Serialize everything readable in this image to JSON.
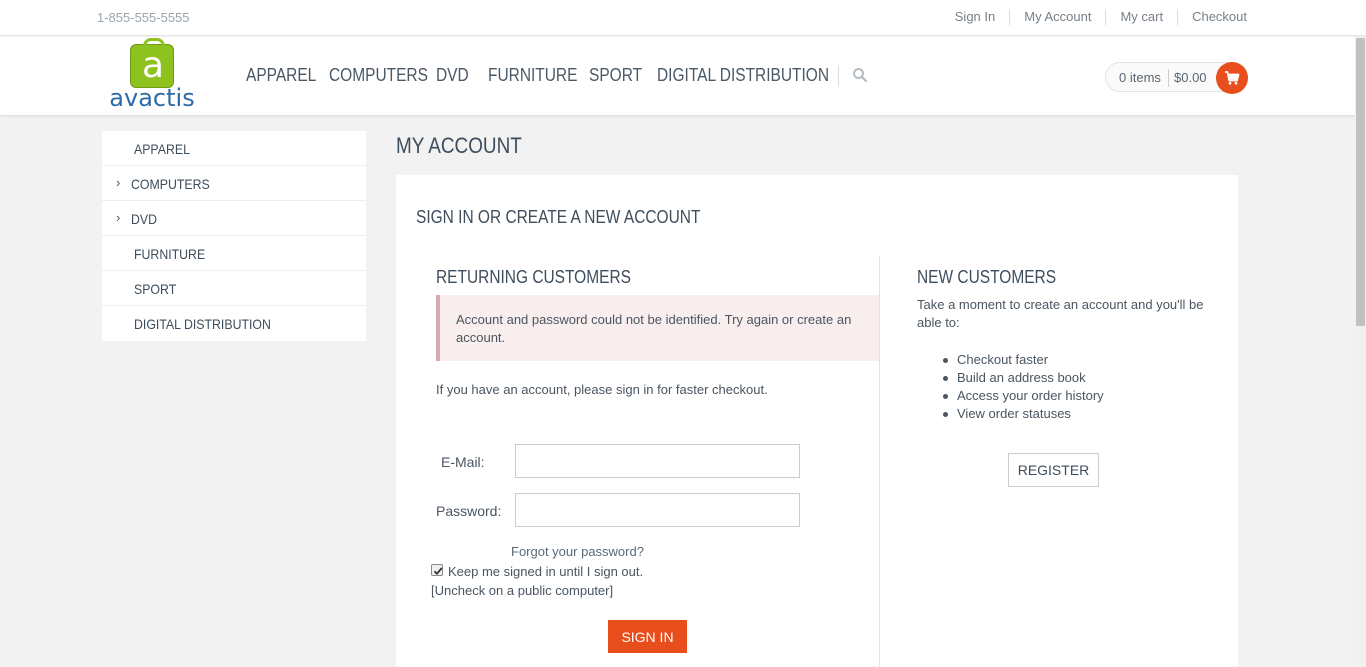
{
  "topbar": {
    "phone": "1-855-555-5555",
    "links": [
      "Sign In",
      "My Account",
      "My cart",
      "Checkout"
    ]
  },
  "header": {
    "logo_letter": "a",
    "logo_text": "avactis",
    "nav": [
      "APPAREL",
      "COMPUTERS",
      "DVD",
      "FURNITURE",
      "SPORT",
      "DIGITAL DISTRIBUTION"
    ],
    "search_icon": "search-icon",
    "cart": {
      "items": "0 items",
      "total": "$0.00",
      "icon": "cart-icon"
    }
  },
  "sidebar": {
    "items": [
      {
        "label": "APPAREL",
        "chevron": ""
      },
      {
        "label": "COMPUTERS",
        "chevron": "›"
      },
      {
        "label": "DVD",
        "chevron": "›"
      },
      {
        "label": "FURNITURE",
        "chevron": ""
      },
      {
        "label": "SPORT",
        "chevron": ""
      },
      {
        "label": "DIGITAL DISTRIBUTION",
        "chevron": ""
      }
    ]
  },
  "main": {
    "page_title": "MY ACCOUNT",
    "panel_title": "SIGN IN OR CREATE A NEW ACCOUNT",
    "returning": {
      "title": "RETURNING CUSTOMERS",
      "alert": "Account and password could not be identified. Try again or create an account.",
      "intro": "If you have an account, please sign in for faster checkout.",
      "email_label": "E-Mail:",
      "email_value": "",
      "password_label": "Password:",
      "password_value": "",
      "forgot": "Forgot your password?",
      "keep_signed": "Keep me signed in until I sign out.",
      "keep_checked": true,
      "uncheck_note": "[Uncheck on a public computer]",
      "signin_label": "SIGN IN"
    },
    "new_customers": {
      "title": "NEW CUSTOMERS",
      "intro": "Take a moment to create an account and you'll be able to:",
      "benefits": [
        "Checkout faster",
        "Build an address book",
        "Access your order history",
        "View order statuses"
      ],
      "register_label": "REGISTER"
    }
  },
  "colors": {
    "accent": "#e84d1c",
    "logo_green": "#8dc21f",
    "logo_blue": "#2d6aa8",
    "alert_bg": "#f9eeee",
    "alert_border": "#d9a8b0"
  }
}
